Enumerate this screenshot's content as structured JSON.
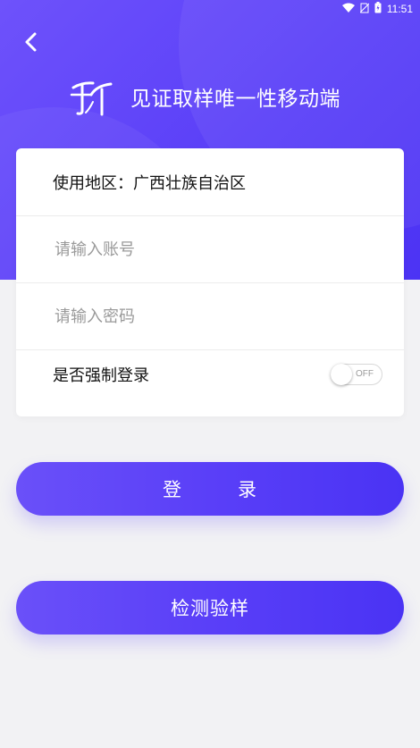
{
  "status_bar": {
    "time": "11:51"
  },
  "header": {
    "title": "见证取样唯一性移动端",
    "logo_text": "建研检测"
  },
  "form": {
    "region_label": "使用地区：",
    "region_value": "广西壮族自治区",
    "account_placeholder": "请输入账号",
    "password_placeholder": "请输入密码",
    "force_login_label": "是否强制登录",
    "force_login_state": "OFF"
  },
  "buttons": {
    "login_char_1": "登",
    "login_char_2": "录",
    "check_sample": "检测验样"
  },
  "colors": {
    "primary": "#5a3ff8",
    "background": "#f2f2f4"
  }
}
